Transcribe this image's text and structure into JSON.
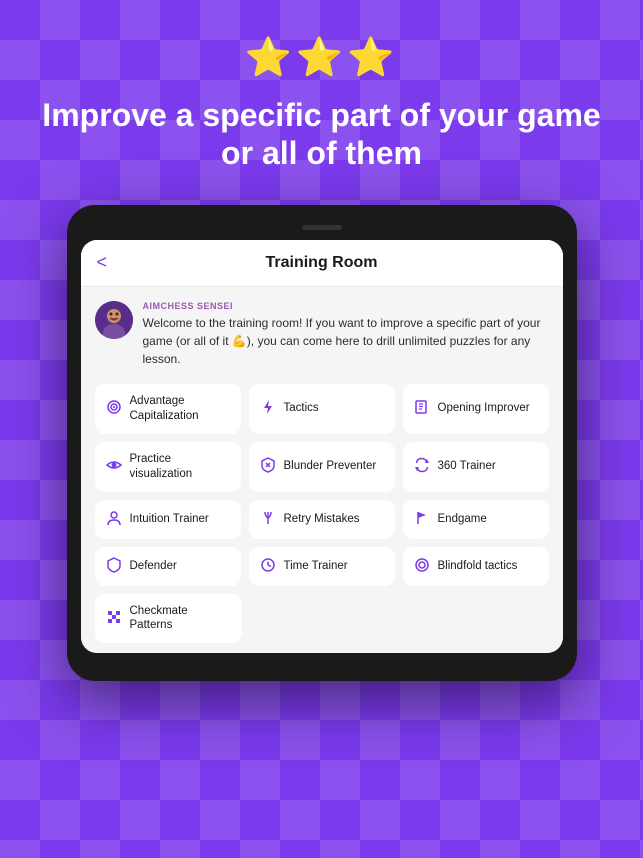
{
  "background": {
    "color": "#7c3aed"
  },
  "hero": {
    "stars": "⭐⭐⭐",
    "headline": "Improve a specific part of your game or all of them"
  },
  "tablet": {
    "header": {
      "back_label": "<",
      "title": "Training Room"
    },
    "sensei": {
      "label": "AIMCHESS SENSEI",
      "message": "Welcome to the training room! If you want to improve a specific part of your game (or all of it 💪), you can come here to drill unlimited puzzles for any lesson."
    },
    "grid_items": [
      {
        "id": "advantage-cap",
        "label": "Advantage Capitalization",
        "icon": "target"
      },
      {
        "id": "tactics",
        "label": "Tactics",
        "icon": "lightning"
      },
      {
        "id": "opening-improver",
        "label": "Opening Improver",
        "icon": "book"
      },
      {
        "id": "practice-vis",
        "label": "Practice visualization",
        "icon": "eye"
      },
      {
        "id": "blunder-preventer",
        "label": "Blunder Preventer",
        "icon": "shield-x"
      },
      {
        "id": "360-trainer",
        "label": "360 Trainer",
        "icon": "rotate"
      },
      {
        "id": "intuition-trainer",
        "label": "Intuition Trainer",
        "icon": "person"
      },
      {
        "id": "retry-mistakes",
        "label": "Retry Mistakes",
        "icon": "fork"
      },
      {
        "id": "endgame",
        "label": "Endgame",
        "icon": "flag"
      },
      {
        "id": "defender",
        "label": "Defender",
        "icon": "shield"
      },
      {
        "id": "time-trainer",
        "label": "Time Trainer",
        "icon": "clock"
      },
      {
        "id": "blindfold",
        "label": "Blindfold tactics",
        "icon": "target-circle"
      },
      {
        "id": "checkmate",
        "label": "Checkmate Patterns",
        "icon": "grid"
      }
    ]
  }
}
